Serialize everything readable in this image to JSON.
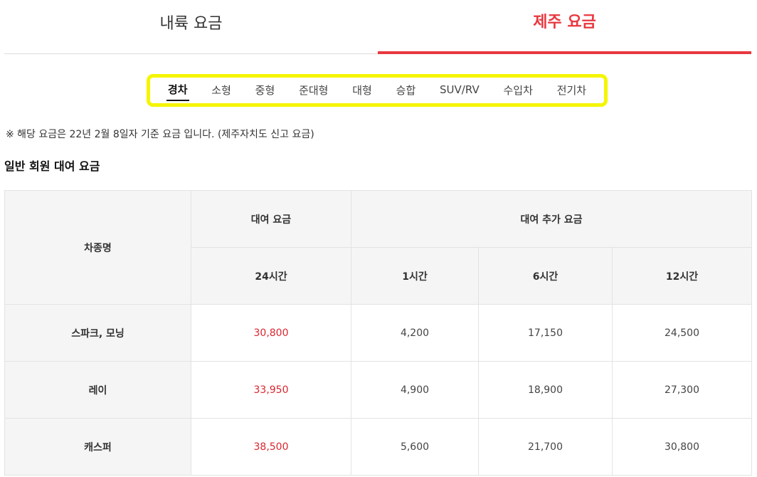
{
  "main_tabs": [
    {
      "label": "내륙 요금",
      "active": false
    },
    {
      "label": "제주 요금",
      "active": true
    }
  ],
  "sub_tabs": [
    {
      "label": "경차",
      "active": true
    },
    {
      "label": "소형",
      "active": false
    },
    {
      "label": "중형",
      "active": false
    },
    {
      "label": "준대형",
      "active": false
    },
    {
      "label": "대형",
      "active": false
    },
    {
      "label": "승합",
      "active": false
    },
    {
      "label": "SUV/RV",
      "active": false
    },
    {
      "label": "수입차",
      "active": false
    },
    {
      "label": "전기차",
      "active": false
    }
  ],
  "notice": "※ 해당 요금은 22년 2월 8일자 기준 요금 입니다. (제주자치도 신고 요금)",
  "section_title": "일반 회원 대여 요금",
  "table": {
    "header_name": "차종명",
    "header_rental": "대여 요금",
    "header_extra": "대여 추가 요금",
    "sub_headers": [
      "24시간",
      "1시간",
      "6시간",
      "12시간"
    ],
    "rows": [
      {
        "name": "스파크, 모닝",
        "h24": "30,800",
        "h1": "4,200",
        "h6": "17,150",
        "h12": "24,500"
      },
      {
        "name": "레이",
        "h24": "33,950",
        "h1": "4,900",
        "h6": "18,900",
        "h12": "27,300"
      },
      {
        "name": "캐스퍼",
        "h24": "38,500",
        "h1": "5,600",
        "h6": "21,700",
        "h12": "30,800"
      }
    ]
  },
  "colors": {
    "accent": "#e8383f",
    "highlight": "#f5f500",
    "price_red": "#d9262f"
  }
}
